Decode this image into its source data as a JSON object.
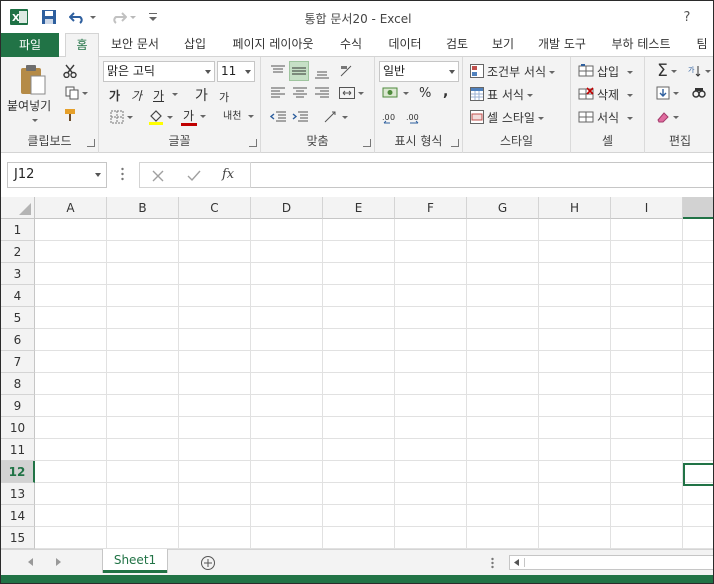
{
  "titlebar": {
    "title": "통합 문서20 - Excel",
    "help": "?",
    "undo_label": "Undo",
    "redo_label": "Redo"
  },
  "tabs": [
    {
      "label": "파일"
    },
    {
      "label": "홈"
    },
    {
      "label": "보안 문서"
    },
    {
      "label": "삽입"
    },
    {
      "label": "페이지 레이아웃"
    },
    {
      "label": "수식"
    },
    {
      "label": "데이터"
    },
    {
      "label": "검토"
    },
    {
      "label": "보기"
    },
    {
      "label": "개발 도구"
    },
    {
      "label": "부하 테스트"
    },
    {
      "label": "팀"
    }
  ],
  "ribbon": {
    "clipboard": {
      "label": "클립보드",
      "paste": "붙여넣기"
    },
    "font": {
      "label": "글꼴",
      "font_name": "맑은 고딕",
      "font_size": "11",
      "bold": "가",
      "italic": "가",
      "underline": "가",
      "grow": "가",
      "shrink": "가",
      "font_color_glyph": "가",
      "phonetic": "내천"
    },
    "alignment": {
      "label": "맞춤"
    },
    "number": {
      "label": "표시 형식",
      "format": "일반",
      "percent": "%",
      "comma": ","
    },
    "styles": {
      "label": "스타일",
      "conditional": "조건부 서식",
      "table": "표 서식",
      "cell_styles": "셀 스타일"
    },
    "cells": {
      "label": "셀",
      "insert": "삽입",
      "delete": "삭제",
      "format": "서식"
    },
    "editing": {
      "label": "편집"
    }
  },
  "formula_bar": {
    "name_box": "J12",
    "fx": "fx",
    "value": ""
  },
  "grid": {
    "columns": [
      "A",
      "B",
      "C",
      "D",
      "E",
      "F",
      "G",
      "H",
      "I"
    ],
    "rows": [
      "1",
      "2",
      "3",
      "4",
      "5",
      "6",
      "7",
      "8",
      "9",
      "10",
      "11",
      "12",
      "13",
      "14",
      "15"
    ],
    "selected_row": "12",
    "selected_cell": "J12"
  },
  "sheets": {
    "active": "Sheet1"
  },
  "colors": {
    "accent": "#217346",
    "ribbon_bg": "#f3f3f3"
  }
}
